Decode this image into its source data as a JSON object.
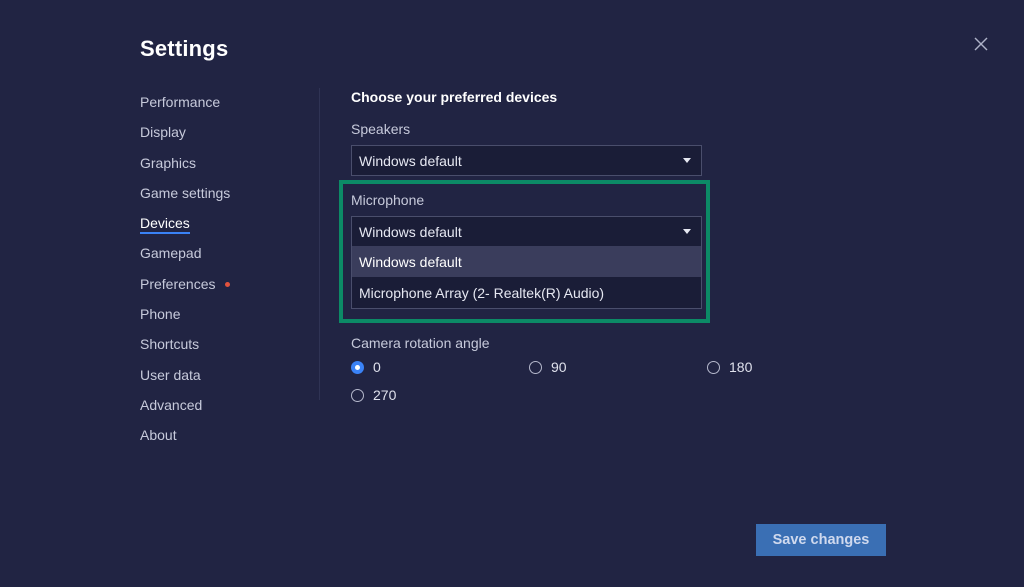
{
  "title": "Settings",
  "close_icon": "close-icon",
  "sidebar": {
    "items": [
      {
        "label": "Performance"
      },
      {
        "label": "Display"
      },
      {
        "label": "Graphics"
      },
      {
        "label": "Game settings"
      },
      {
        "label": "Devices",
        "active": true
      },
      {
        "label": "Gamepad"
      },
      {
        "label": "Preferences",
        "badge_dot": true
      },
      {
        "label": "Phone"
      },
      {
        "label": "Shortcuts"
      },
      {
        "label": "User data"
      },
      {
        "label": "Advanced"
      },
      {
        "label": "About"
      }
    ]
  },
  "main": {
    "heading": "Choose your preferred devices",
    "speakers": {
      "label": "Speakers",
      "value": "Windows default"
    },
    "microphone": {
      "label": "Microphone",
      "value": "Windows default",
      "options": [
        "Windows default",
        "Microphone Array (2- Realtek(R) Audio)"
      ],
      "selected_option": "Windows default"
    },
    "camera": {
      "label": "Camera rotation angle",
      "options": [
        "0",
        "90",
        "180",
        "270"
      ],
      "selected": "0"
    }
  },
  "save_label": "Save changes",
  "colors": {
    "background": "#212443",
    "accent": "#3a82f6",
    "highlight_border": "#0c8a66",
    "badge_dot": "#e2523d",
    "save_button": "#3a6fb4"
  }
}
